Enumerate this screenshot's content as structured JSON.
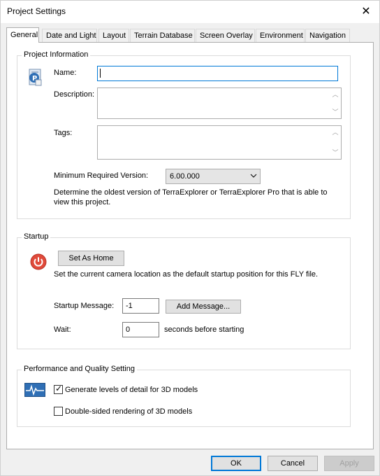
{
  "window": {
    "title": "Project Settings",
    "close_glyph": "✕"
  },
  "tabs": [
    {
      "label": "General",
      "active": true
    },
    {
      "label": "Date and Light"
    },
    {
      "label": "Layout"
    },
    {
      "label": "Terrain Database"
    },
    {
      "label": "Screen Overlay"
    },
    {
      "label": "Environment"
    },
    {
      "label": "Navigation"
    }
  ],
  "project_info": {
    "group_title": "Project Information",
    "icon": "project-file-icon",
    "name_label": "Name:",
    "name_value": "",
    "description_label": "Description:",
    "description_value": "",
    "tags_label": "Tags:",
    "tags_value": "",
    "min_version_label": "Minimum Required Version:",
    "min_version_value": "6.00.000",
    "min_version_help": "Determine the oldest version of TerraExplorer or TerraExplorer Pro that is able to view this project."
  },
  "startup": {
    "group_title": "Startup",
    "icon": "power-icon",
    "set_home_label": "Set As Home",
    "set_home_help": "Set the current camera location as the default startup position for this FLY file.",
    "startup_message_label": "Startup Message:",
    "startup_message_value": "-1",
    "add_message_label": "Add Message...",
    "wait_label": "Wait:",
    "wait_value": "0",
    "wait_suffix": "seconds before starting"
  },
  "performance": {
    "group_title": "Performance and Quality Setting",
    "icon": "performance-icon",
    "lod_label": "Generate levels of detail for 3D models",
    "lod_checked": true,
    "double_sided_label": "Double-sided rendering of 3D models",
    "double_sided_checked": false
  },
  "footer": {
    "ok_label": "OK",
    "cancel_label": "Cancel",
    "apply_label": "Apply"
  },
  "colors": {
    "accent": "#0078d7",
    "power_red": "#e04a3a",
    "perf_blue": "#2f6fb5"
  }
}
